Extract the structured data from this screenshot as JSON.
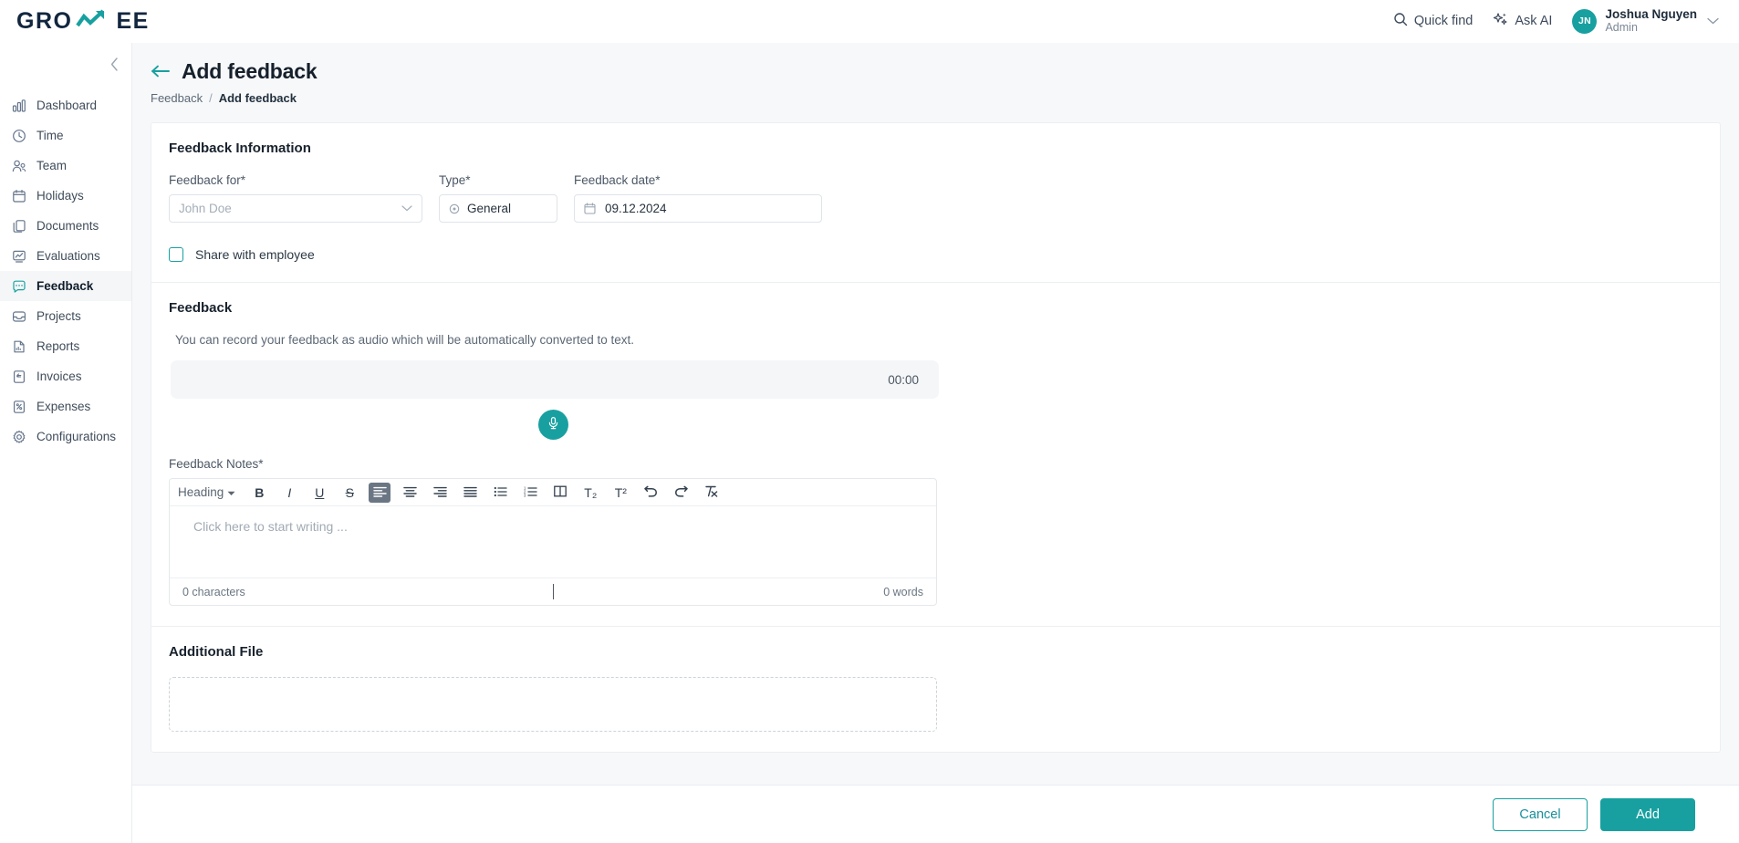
{
  "brand": {
    "logo_left": "GRO",
    "logo_right": "EE",
    "logo_mark": "growth-arrow",
    "accent_color": "#18a0a0"
  },
  "topbar": {
    "quick_find": "Quick find",
    "ask_ai": "Ask AI",
    "user": {
      "initials": "JN",
      "name": "Joshua Nguyen",
      "role": "Admin"
    }
  },
  "sidebar": {
    "items": [
      {
        "label": "Dashboard",
        "icon": "bar-chart-icon",
        "active": false
      },
      {
        "label": "Time",
        "icon": "clock-icon",
        "active": false
      },
      {
        "label": "Team",
        "icon": "users-icon",
        "active": false
      },
      {
        "label": "Holidays",
        "icon": "calendar-icon",
        "active": false
      },
      {
        "label": "Documents",
        "icon": "documents-icon",
        "active": false
      },
      {
        "label": "Evaluations",
        "icon": "evaluation-icon",
        "active": false
      },
      {
        "label": "Feedback",
        "icon": "chat-bubble-icon",
        "active": true
      },
      {
        "label": "Projects",
        "icon": "inbox-icon",
        "active": false
      },
      {
        "label": "Reports",
        "icon": "report-file-icon",
        "active": false
      },
      {
        "label": "Invoices",
        "icon": "invoice-icon",
        "active": false
      },
      {
        "label": "Expenses",
        "icon": "expense-icon",
        "active": false
      },
      {
        "label": "Configurations",
        "icon": "gear-icon",
        "active": false
      }
    ]
  },
  "page": {
    "title": "Add feedback",
    "breadcrumb": {
      "parent": "Feedback",
      "separator": "/",
      "current": "Add feedback"
    }
  },
  "feedback_information": {
    "section_title": "Feedback Information",
    "feedback_for": {
      "label": "Feedback for*",
      "placeholder": "John Doe",
      "value": ""
    },
    "type": {
      "label": "Type*",
      "value": "General"
    },
    "feedback_date": {
      "label": "Feedback date*",
      "value": "09.12.2024"
    },
    "share_with_employee": {
      "label": "Share with employee",
      "checked": false
    }
  },
  "feedback_section": {
    "section_title": "Feedback",
    "hint": "You can record your feedback as audio which will be automatically converted to text.",
    "recorder_time": "00:00",
    "mic_button": "record-audio",
    "notes_label": "Feedback Notes*",
    "toolbar": {
      "heading": "Heading",
      "bold": "B",
      "italic": "I",
      "underline": "U",
      "strikethrough": "S",
      "align_left": "align-left",
      "align_center": "align-center",
      "align_right": "align-right",
      "align_justify": "align-justify",
      "bullet_list": "bullet-list",
      "numbered_list": "numbered-list",
      "columns": "columns",
      "subscript": "T₂",
      "superscript": "T²",
      "undo": "undo",
      "redo": "redo",
      "clear_format": "clear-formatting"
    },
    "editor_placeholder": "Click here to start writing ...",
    "char_count": "0 characters",
    "word_count": "0 words"
  },
  "additional_file": {
    "section_title": "Additional File"
  },
  "footer": {
    "cancel": "Cancel",
    "add": "Add"
  }
}
